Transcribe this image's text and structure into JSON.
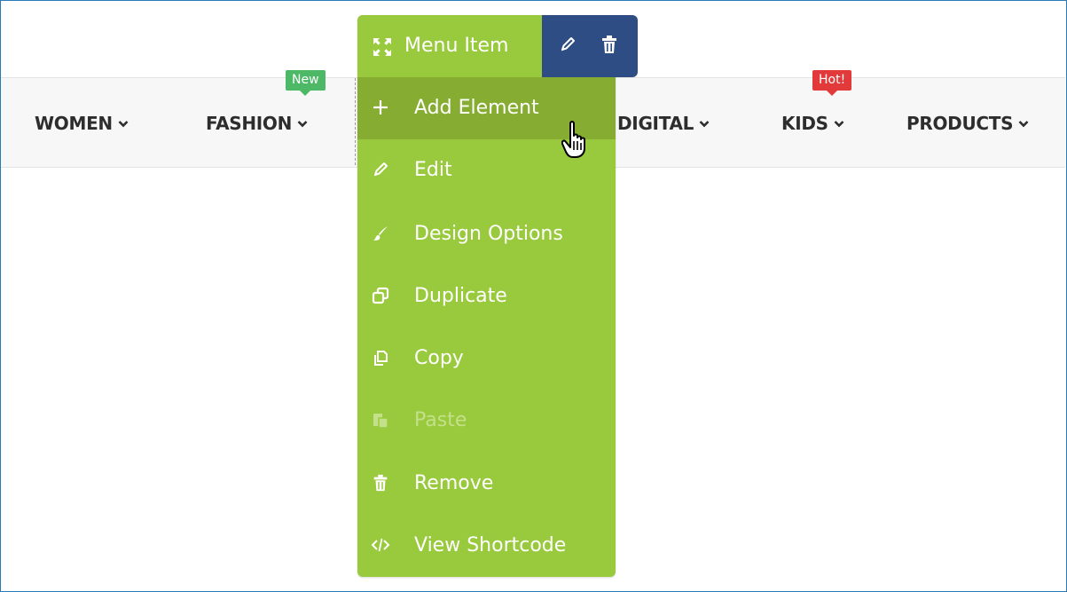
{
  "nav": {
    "items": [
      {
        "label": "WOMEN"
      },
      {
        "label": "FASHION"
      },
      {
        "label": "DIGITAL"
      },
      {
        "label": "KIDS"
      },
      {
        "label": "PRODUCTS"
      }
    ],
    "badge_new": "New",
    "badge_hot": "Hot!"
  },
  "menu": {
    "title": "Menu Item",
    "items": [
      {
        "label": "Add Element",
        "icon": "plus-icon"
      },
      {
        "label": "Edit",
        "icon": "pencil-icon"
      },
      {
        "label": "Design Options",
        "icon": "paintbrush-icon"
      },
      {
        "label": "Duplicate",
        "icon": "duplicate-icon"
      },
      {
        "label": "Copy",
        "icon": "copy-icon"
      },
      {
        "label": "Paste",
        "icon": "paste-icon"
      },
      {
        "label": "Remove",
        "icon": "trash-icon"
      },
      {
        "label": "View Shortcode",
        "icon": "code-icon"
      }
    ]
  },
  "colors": {
    "menu_green": "#99c93c",
    "menu_hover": "#86ad31",
    "header_dark": "#2f4d85",
    "badge_new": "#4db866",
    "badge_hot": "#e23a3a",
    "frame_border": "#2a7ab8"
  }
}
